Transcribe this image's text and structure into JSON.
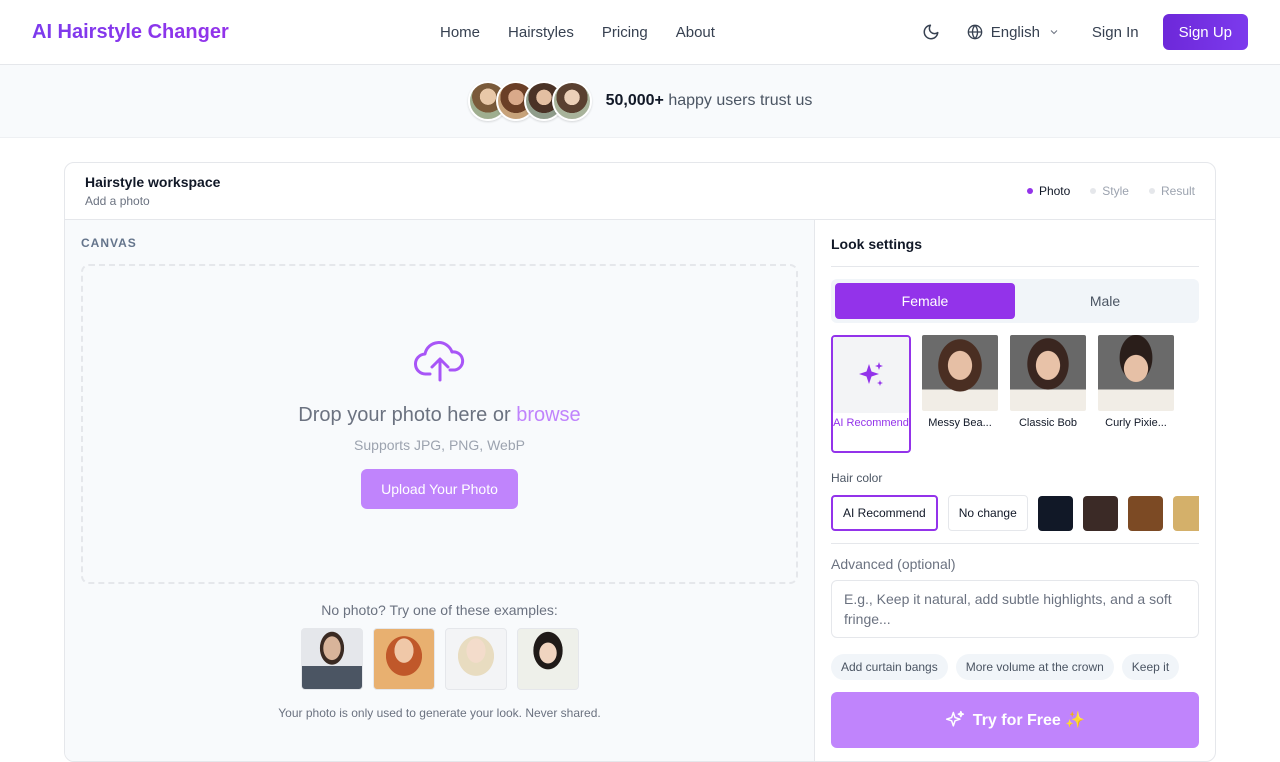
{
  "brand": "AI Hairstyle Changer",
  "nav": {
    "links": [
      "Home",
      "Hairstyles",
      "Pricing",
      "About"
    ],
    "language": "English",
    "sign_in": "Sign In",
    "sign_up": "Sign Up"
  },
  "trust": {
    "count": "50,000+",
    "text": "happy users trust us"
  },
  "workspace": {
    "title": "Hairstyle workspace",
    "subtitle": "Add a photo",
    "steps": [
      "Photo",
      "Style",
      "Result"
    ],
    "active_step": "Photo"
  },
  "canvas": {
    "label": "CANVAS",
    "drop_text": "Drop your photo here or",
    "browse": "browse",
    "supports": "Supports JPG, PNG, WebP",
    "upload_button": "Upload Your Photo",
    "examples_label": "No photo? Try one of these examples:",
    "privacy": "Your photo is only used to generate your look. Never shared."
  },
  "look": {
    "title": "Look settings",
    "genders": [
      "Female",
      "Male"
    ],
    "active_gender": "Female",
    "styles": [
      "AI Recommend",
      "Messy Bea...",
      "Classic Bob",
      "Curly Pixie..."
    ],
    "hair_color_label": "Hair color",
    "color_chips": [
      "AI Recommend",
      "No change"
    ],
    "swatches": [
      "#111827",
      "#3b2a26",
      "#7c4a24",
      "#d4b06a"
    ],
    "advanced_label": "Advanced (optional)",
    "advanced_placeholder": "E.g., Keep it natural, add subtle highlights, and a soft fringe...",
    "suggestions": [
      "Add curtain bangs",
      "More volume at the crown",
      "Keep it"
    ],
    "try_button": "Try for Free ✨"
  },
  "colors": {
    "accent": "#9333ea",
    "accent_light": "#c084fc"
  }
}
